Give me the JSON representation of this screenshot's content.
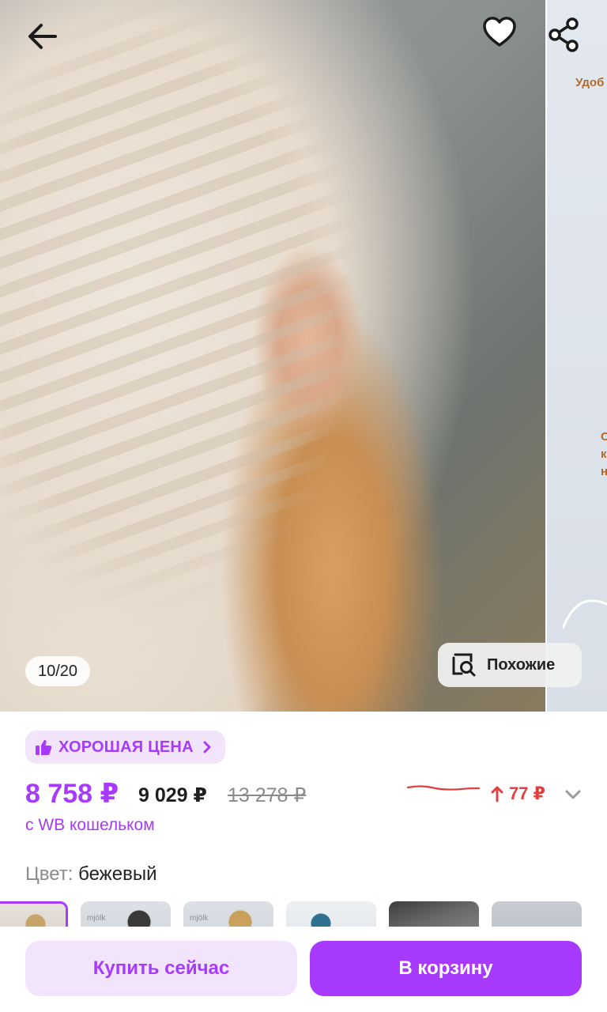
{
  "gallery": {
    "counter": "10/20",
    "similar_label": "Похожие",
    "next_slide_texts": [
      "Удоб",
      "С",
      "к",
      "н"
    ],
    "icons": {
      "back": "arrow-left-icon",
      "favorite": "heart-icon",
      "share": "share-icon",
      "similar": "image-search-icon"
    }
  },
  "badge": {
    "label": "ХОРОШАЯ ЦЕНА",
    "icon": "thumbs-up-icon",
    "chevron": "chevron-right-icon"
  },
  "price": {
    "main": "8 758 ₽",
    "second": "9 029 ₽",
    "old": "13 278 ₽",
    "wallet_note": "с WB кошельком",
    "change": "77 ₽",
    "change_direction": "up",
    "change_icon": "arrow-up-icon",
    "expand_icon": "chevron-down-icon"
  },
  "color": {
    "label": "Цвет:",
    "value": "бежевый"
  },
  "thumbs": [
    {
      "label": "",
      "selected": true
    },
    {
      "label": "mjölk",
      "selected": false
    },
    {
      "label": "mjölk",
      "selected": false
    },
    {
      "label": "",
      "selected": false
    },
    {
      "label": "",
      "selected": false
    },
    {
      "label": "",
      "selected": false
    }
  ],
  "actions": {
    "buy_now": "Купить сейчас",
    "add_to_cart": "В корзину"
  },
  "colors": {
    "accent": "#a73afd",
    "accent_light": "#f1e4fb",
    "price_up": "#e0403f"
  }
}
